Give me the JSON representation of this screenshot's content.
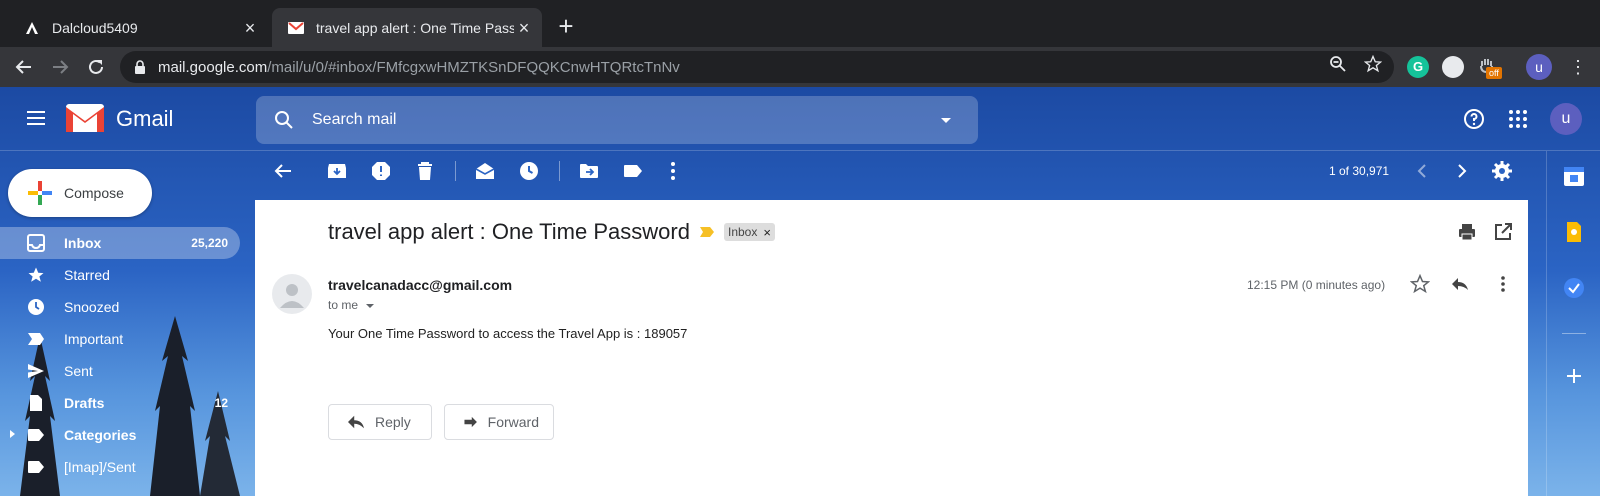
{
  "browser": {
    "tabs": [
      {
        "title": "Dalcloud5409",
        "active": false
      },
      {
        "title": "travel app alert : One Time Passw",
        "active": true
      }
    ],
    "url_host": "mail.google.com",
    "url_path": "/mail/u/0/#inbox/FMfcgxwHMZTKSnDFQQKCnwHTQRtcTnNv",
    "extension_badge": "off",
    "profile_initial": "u"
  },
  "gmail": {
    "logo_text": "Gmail",
    "search_placeholder": "Search mail",
    "account_initial": "u",
    "compose_label": "Compose",
    "nav": [
      {
        "label": "Inbox",
        "count": "25,220",
        "icon": "inbox-icon"
      },
      {
        "label": "Starred",
        "count": "",
        "icon": "star-icon"
      },
      {
        "label": "Snoozed",
        "count": "",
        "icon": "clock-icon"
      },
      {
        "label": "Important",
        "count": "",
        "icon": "important-icon"
      },
      {
        "label": "Sent",
        "count": "",
        "icon": "send-icon"
      },
      {
        "label": "Drafts",
        "count": "12",
        "icon": "draft-icon"
      },
      {
        "label": "Categories",
        "count": "",
        "icon": "label-icon"
      },
      {
        "label": "[Imap]/Sent",
        "count": "",
        "icon": "folder-icon"
      }
    ],
    "pager": "1 of 30,971"
  },
  "message": {
    "subject": "travel app alert : One Time Password",
    "label_chip": "Inbox",
    "sender": "travelcanadacc@gmail.com",
    "recipient": "to me",
    "time": "12:15 PM (0 minutes ago)",
    "body": "Your One Time Password to access the Travel App is : 189057",
    "reply_label": "Reply",
    "forward_label": "Forward"
  },
  "colors": {
    "accent_blue": "#1c4aa3",
    "gmail_red": "#ea4335",
    "important_yellow": "#f6c026"
  }
}
